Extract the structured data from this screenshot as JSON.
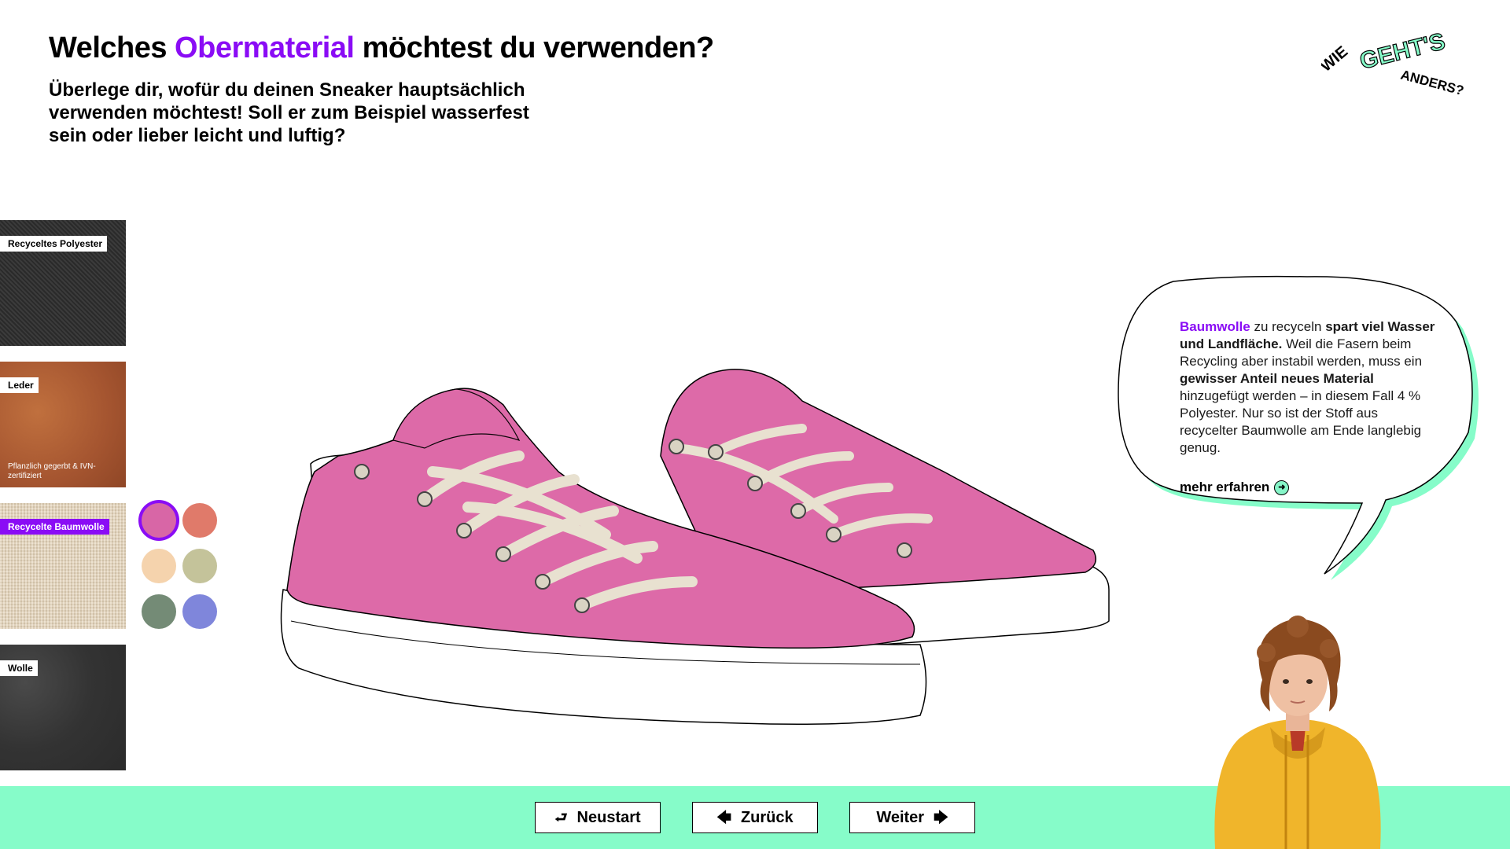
{
  "header": {
    "title_before": "Welches",
    "title_accent": "Obermaterial",
    "title_after": "möchtest du verwenden?",
    "subtitle": "Überlege dir, wofür du deinen Sneaker hauptsächlich verwenden möchtest! Soll er zum Beispiel wasserfest sein oder lieber leicht und luftig?"
  },
  "logo": {
    "text_wie": "WIE",
    "text_gehts": "GEHT'S",
    "text_anders": "ANDERS?"
  },
  "materials": [
    {
      "label": "Recyceltes Polyester",
      "note": "",
      "selected": false
    },
    {
      "label": "Leder",
      "note": "Pflanzlich gegerbt & IVN-zertifiziert",
      "selected": false
    },
    {
      "label": "Recycelte Baumwolle",
      "note": "",
      "selected": true
    },
    {
      "label": "Wolle",
      "note": "",
      "selected": false
    }
  ],
  "colors": [
    {
      "hex": "#d866a6",
      "selected": true
    },
    {
      "hex": "#e07a6a",
      "selected": false
    },
    {
      "hex": "#f5d3ad",
      "selected": false
    },
    {
      "hex": "#c4c39a",
      "selected": false
    },
    {
      "hex": "#748b76",
      "selected": false
    },
    {
      "hex": "#7f86db",
      "selected": false
    }
  ],
  "shoe": {
    "upper_color": "#dd6aa8",
    "lace_color": "#e8e1d0",
    "sole_color": "#ffffff"
  },
  "bubble": {
    "accent_word": "Baumwolle",
    "t1": " zu recyceln ",
    "b1": "spart viel Wasser und Landfläche.",
    "t2": " Weil die Fasern beim Recycling aber instabil werden, muss ein ",
    "b2": "gewisser Anteil neues Material",
    "t3": " hinzugefügt werden – in diesem Fall 4 % Polyester. Nur so ist der Stoff aus recycelter Baumwolle am Ende langlebig genug.",
    "more_link": "mehr erfahren"
  },
  "footer": {
    "restart_label": "Neustart",
    "back_label": "Zurück",
    "next_label": "Weiter"
  },
  "theme": {
    "accent": "#8a0cf5",
    "mint": "#86fcc9"
  }
}
